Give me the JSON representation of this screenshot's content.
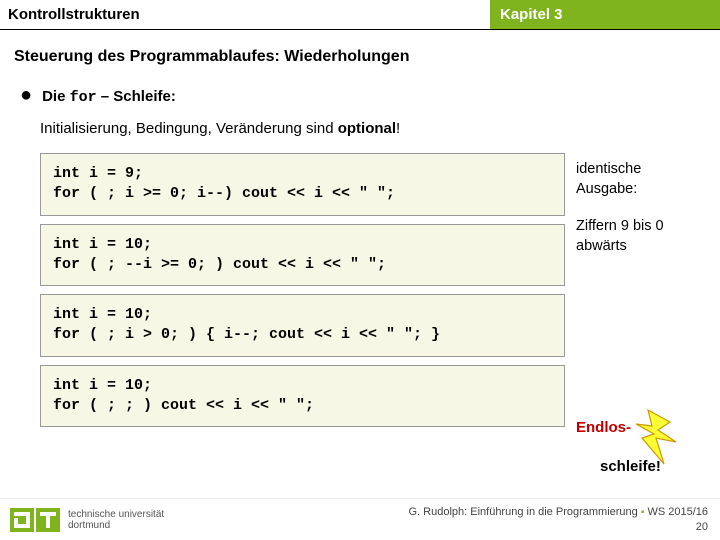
{
  "header": {
    "left": "Kontrollstrukturen",
    "right": "Kapitel 3"
  },
  "subtitle": "Steuerung des Programmablaufes: Wiederholungen",
  "bullet": {
    "pre": "Die ",
    "kw": "for",
    "post": " – Schleife:"
  },
  "desc": {
    "pre": "Initialisierung, Bedingung, Veränderung sind ",
    "bold": "optional",
    "post": "!"
  },
  "code": {
    "c1": "int i = 9;\nfor ( ; i >= 0; i--) cout << i << \" \";",
    "c2": "int i = 10;\nfor ( ; --i >= 0; ) cout << i << \" \";",
    "c3": "int i = 10;\nfor ( ; i > 0; ) { i--; cout << i << \" \"; }",
    "c4": "int i = 10;\nfor ( ; ; ) cout << i << \" \";"
  },
  "annot": {
    "ident": "identische\nAusgabe:",
    "digits": "Ziffern 9 bis 0\nabwärts"
  },
  "endlos": {
    "p1": "Endlos-",
    "p2": "schleife!"
  },
  "logo": {
    "l1": "technische universität",
    "l2": "dortmund"
  },
  "footer": {
    "course": "G. Rudolph: Einführung in die Programmierung",
    "sem": "WS 2015/16",
    "page": "20"
  }
}
